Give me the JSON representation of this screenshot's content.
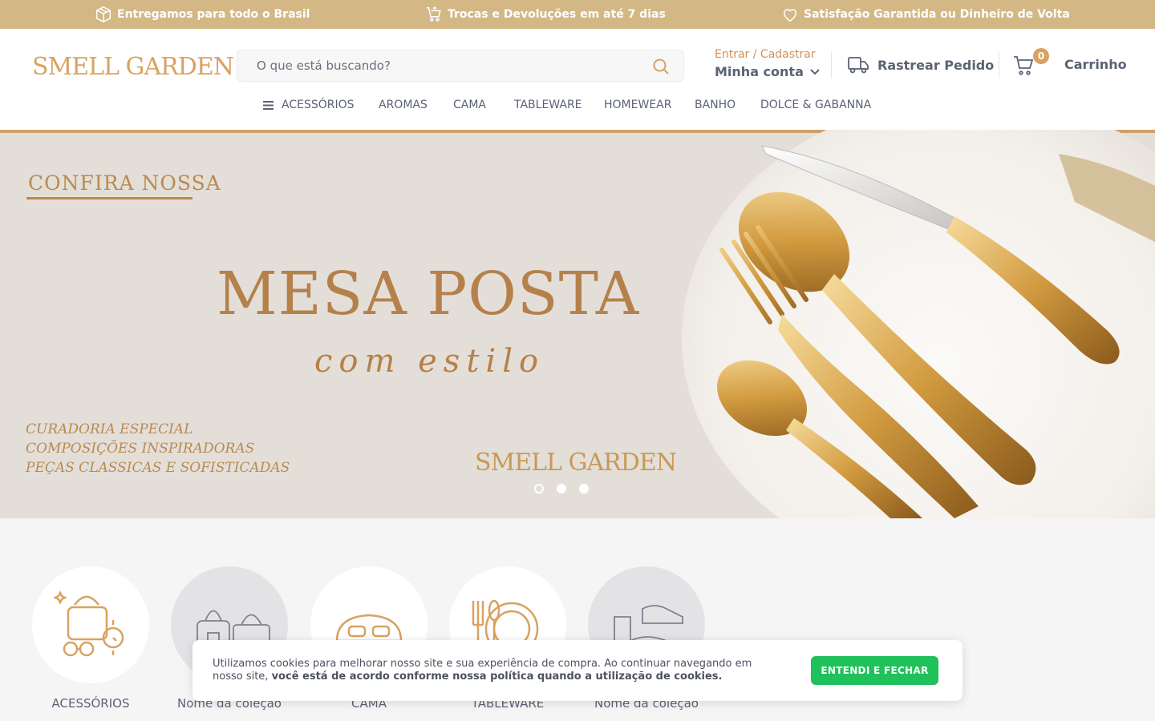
{
  "topbar": {
    "items": [
      {
        "icon": "box-icon",
        "text": "Entregamos para todo o Brasil"
      },
      {
        "icon": "cart-return-icon",
        "text": "Trocas e Devoluções em até 7 dias"
      },
      {
        "icon": "heart-icon",
        "text": "Satisfação Garantida ou Dinheiro de Volta"
      }
    ]
  },
  "header": {
    "logo_text": "SMELL GARDEN",
    "search_placeholder": "O que está buscando?",
    "account": {
      "enter_label": "Entrar / Cadastrar",
      "my_account_label": "Minha conta"
    },
    "track_label": "Rastrear Pedido",
    "cart": {
      "count": "0",
      "label": "Carrinho"
    }
  },
  "nav": {
    "items": [
      "ACESSÓRIOS",
      "AROMAS",
      "CAMA",
      "TABLEWARE",
      "HOMEWEAR",
      "BANHO",
      "DOLCE & GABANNA"
    ]
  },
  "hero": {
    "kicker": "CONFIRA NOSSA",
    "title": "MESA POSTA",
    "subtitle": "com estilo",
    "features": [
      "CURADORIA ESPECIAL",
      "COMPOSIÇÕES INSPIRADORAS",
      "PEÇAS CLASSICAS E SOFISTICADAS"
    ],
    "brand": "SMELL GARDEN",
    "slides_total": 3,
    "active_slide": 1
  },
  "collections": [
    {
      "name": "ACESSÓRIOS",
      "icon": "bag-watch-glasses-icon"
    },
    {
      "name": "Nome da coleção",
      "icon": "bags-icon"
    },
    {
      "name": "CAMA",
      "icon": "bed-icon"
    },
    {
      "name": "TABLEWARE",
      "icon": "plate-cutlery-icon"
    },
    {
      "name": "Nome da coleção",
      "icon": "shoes-icon"
    }
  ],
  "cookie": {
    "text_plain": "Utilizamos cookies para melhorar nosso site e sua experiência de compra. Ao continuar navegando em nosso site,",
    "text_bold": "você está de acordo conforme nossa política quando a utilização de cookies.",
    "button_label": "ENTENDI E FECHAR"
  },
  "colors": {
    "topbar_bg": "#d3b886",
    "accent_gold": "#d9a25f",
    "cookie_button": "#1fc15a",
    "text": "#5b6275"
  }
}
